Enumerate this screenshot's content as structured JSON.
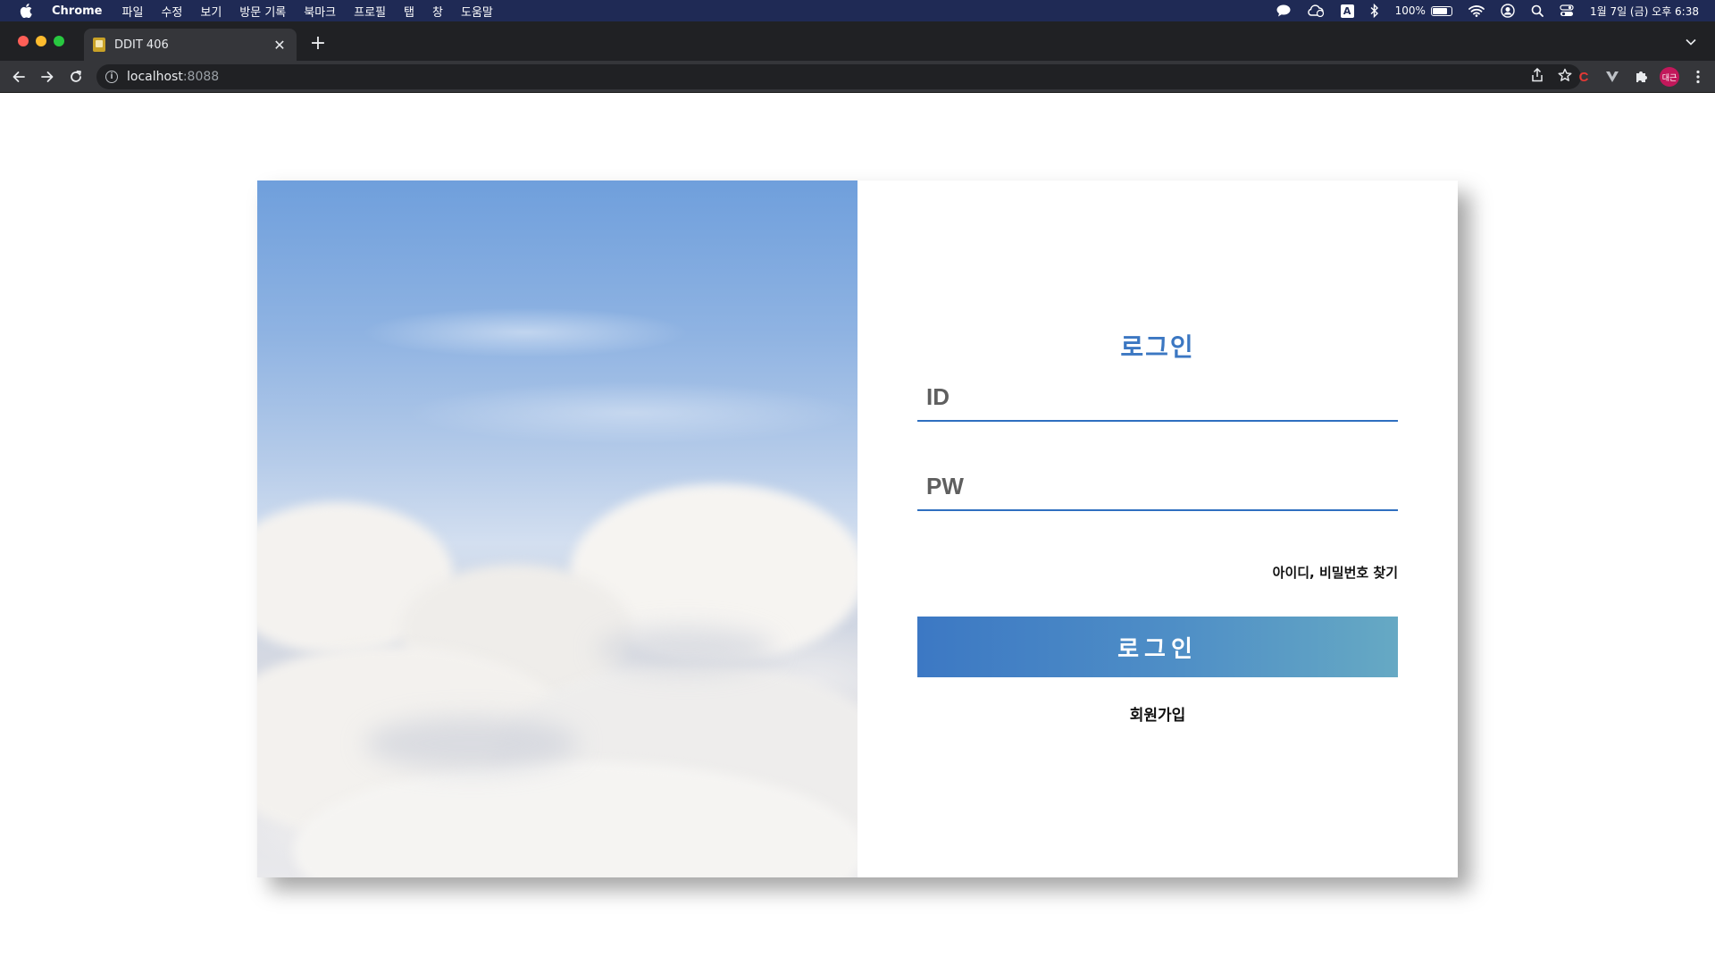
{
  "menubar": {
    "app_name": "Chrome",
    "items": [
      "파일",
      "수정",
      "보기",
      "방문 기록",
      "북마크",
      "프로필",
      "탭",
      "창",
      "도움말"
    ],
    "battery": "100%",
    "datetime": "1월 7일 (금) 오후 6:38",
    "keyboard_indicator": "A"
  },
  "browser": {
    "tab_title": "DDIT 406",
    "url_host": "localhost",
    "url_port": ":8088",
    "profile_initials": "대근"
  },
  "login": {
    "title": "로그인",
    "id_placeholder": "ID",
    "pw_placeholder": "PW",
    "find_link": "아이디, 비밀번호 찾기",
    "submit_label": "로그인",
    "signup_link": "회원가입"
  },
  "colors": {
    "accent": "#3b77c2",
    "button_gradient_start": "#3c78c4",
    "button_gradient_end": "#66a9c4",
    "menubar_bg": "#1f2a55"
  }
}
